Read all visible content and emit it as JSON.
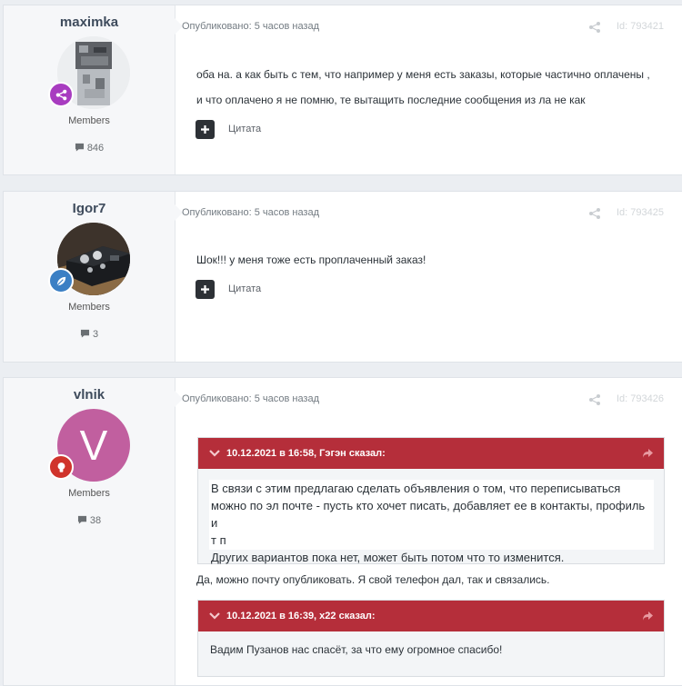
{
  "posts": [
    {
      "author": "maximka",
      "group": "Members",
      "count": "846",
      "meta": "Опубликовано: 5 часов назад",
      "id": "Id: 793421",
      "lines": [
        "оба на. а как быть с тем, что например у меня есть заказы, которые частично оплачены ,",
        "и что оплачено я не помню, те вытащить последние сообщения из ла не как"
      ],
      "quote_label": "Цитата",
      "badge_icon": "share-nodes-icon",
      "badge_color": "#a83cc0"
    },
    {
      "author": "Igor7",
      "group": "Members",
      "count": "3",
      "meta": "Опубликовано: 5 часов назад",
      "id": "Id: 793425",
      "lines": [
        "Шок!!! у меня тоже есть проплаченный заказ!"
      ],
      "quote_label": "Цитата",
      "badge_icon": "leaf-icon",
      "badge_color": "#3b7fc4"
    },
    {
      "author": "vlnik",
      "group": "Members",
      "count": "38",
      "meta": "Опубликовано: 5 часов назад",
      "id": "Id: 793426",
      "avatar_letter": "V",
      "avatar_color": "#c15f9f",
      "badge_icon": "lightbulb-icon",
      "badge_color": "#d0342c",
      "quote1": {
        "cite": "10.12.2021 в 16:58, Гэгэн сказал:",
        "lines": [
          "В связи с этим предлагаю сделать объявления о том, что переписываться",
          "можно по эл почте - пусть кто хочет писать, добавляет ее в контакты, профиль и",
          "т п",
          "Других вариантов пока нет, может быть потом что то изменится."
        ]
      },
      "text": "Да, можно почту опубликовать. Я свой телефон дал, так и связались.",
      "quote2": {
        "cite": "10.12.2021 в 16:39, x22 сказал:",
        "text": "Вадим Пузанов нас спасёт, за что ему огромное спасибо!"
      }
    }
  ],
  "colors": {
    "quote_header": "#b52e3a",
    "background": "#ebeef2"
  }
}
